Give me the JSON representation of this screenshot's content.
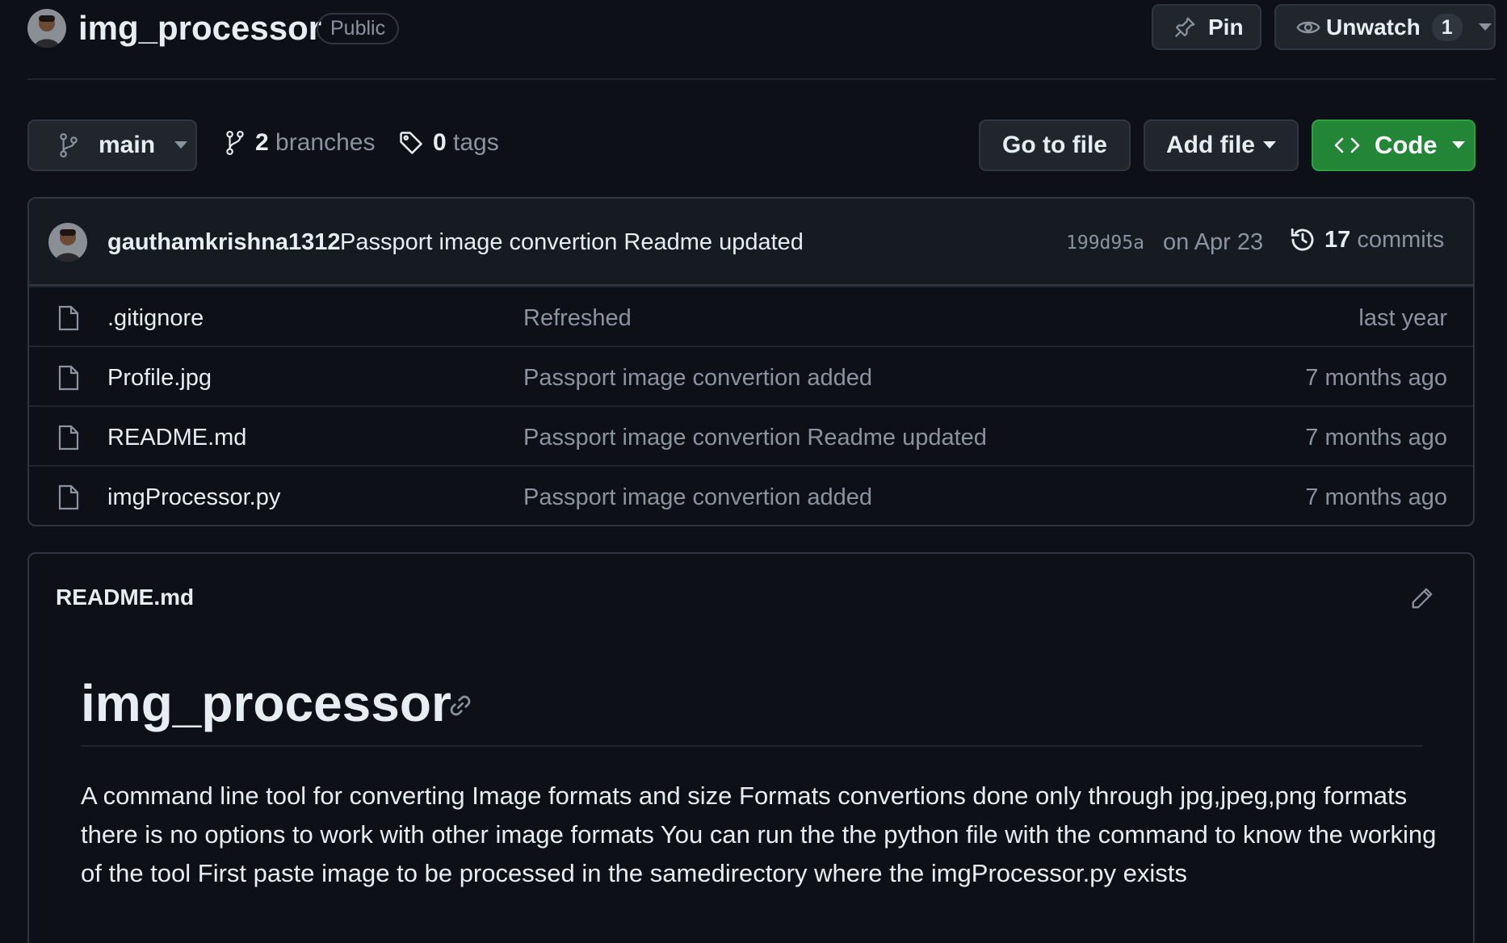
{
  "repo": {
    "name": "img_processor",
    "visibility": "Public"
  },
  "actions": {
    "pin_label": "Pin",
    "watch_label": "Unwatch",
    "watch_count": "1"
  },
  "branch_bar": {
    "current_branch": "main",
    "branches_count": "2",
    "branches_label": "branches",
    "tags_count": "0",
    "tags_label": "tags",
    "goto_file_label": "Go to file",
    "add_file_label": "Add file",
    "code_label": "Code"
  },
  "latest_commit": {
    "author": "gauthamkrishna1312",
    "message": "Passport image convertion Readme updated",
    "sha": "199d95a",
    "date": "on Apr 23",
    "commits_count": "17",
    "commits_label": "commits"
  },
  "files": [
    {
      "name": ".gitignore",
      "commit": "Refreshed",
      "time": "last year"
    },
    {
      "name": "Profile.jpg",
      "commit": "Passport image convertion added",
      "time": "7 months ago"
    },
    {
      "name": "README.md",
      "commit": "Passport image convertion Readme updated",
      "time": "7 months ago"
    },
    {
      "name": "imgProcessor.py",
      "commit": "Passport image convertion added",
      "time": "7 months ago"
    }
  ],
  "readme": {
    "file_label": "README.md",
    "heading": "img_processor",
    "body": "A command line tool for converting Image formats and size Formats convertions done only through jpg,jpeg,png formats there is no options to work with other image formats You can run the the python file with the command to know the working of the tool First paste image to be processed in the samedirectory where the imgProcessor.py exists"
  },
  "colors": {
    "background": "#0d1117",
    "border": "#30363d",
    "code_button": "#238636",
    "muted_text": "#8b949e"
  }
}
